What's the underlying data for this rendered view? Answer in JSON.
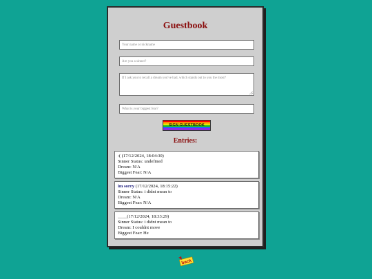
{
  "page": {
    "title": "Guestbook"
  },
  "form": {
    "name_placeholder": "Your name or nickname",
    "sinner_placeholder": "Are you a sinner?",
    "dream_placeholder": "If I ask you to recall a dream you've had, which stands out to you the most?",
    "fear_placeholder": "What is your biggest fear?",
    "submit_label": "SIGN GUESTBOOK"
  },
  "entries_title": "Entries:",
  "entries": [
    {
      "name": ":(",
      "timestamp": "(17/12/2024, 18:04:30)",
      "sinner": "Sinner Status: undefined",
      "dream": "Dream: N/A",
      "fear": "Biggest Fear: N/A"
    },
    {
      "name": "im sorry",
      "timestamp": "(17/12/2024, 18:15:22)",
      "sinner": "Sinner Status: i didnt mean to",
      "dream": "Dream: N/A",
      "fear": "Biggest Fear: N/A"
    },
    {
      "name": "____",
      "timestamp": "(17/12/2024, 18:33:29)",
      "sinner": "Sinner Status: i didnt mean to",
      "dream": "Dream: I couldnt move",
      "fear": "Biggest Fear: He"
    }
  ],
  "back_label": "back",
  "colors": {
    "background": "#0fa394",
    "panel": "#cfcfcf",
    "heading": "#8b1010"
  },
  "icons": {
    "back": "back-arrow-sticker-icon"
  }
}
